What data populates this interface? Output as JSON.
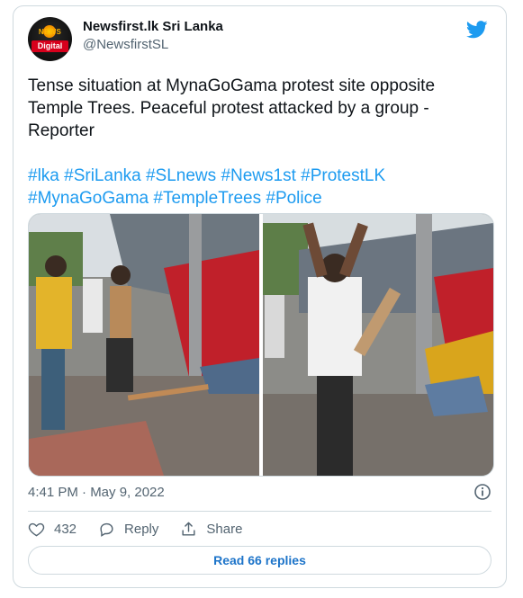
{
  "author": {
    "name": "Newsfirst.lk Sri Lanka",
    "handle": "@NewsfirstSL",
    "avatar_logo_top": "NEWS",
    "avatar_logo_bottom": "Digital"
  },
  "tweet": {
    "text": "Tense situation at MynaGoGama protest site opposite Temple Trees. Peaceful protest attacked by a group - Reporter",
    "hashtags": [
      "#lka",
      "#SriLanka",
      "#SLnews",
      "#News1st",
      "#ProtestLK",
      "#MynaGoGama",
      "#TempleTrees",
      "#Police"
    ],
    "timestamp": "4:41 PM · May 9, 2022"
  },
  "actions": {
    "likes": "432",
    "reply_label": "Reply",
    "share_label": "Share",
    "read_replies": "Read 66 replies"
  },
  "icons": {
    "brand": "twitter-bird-icon",
    "info": "info-icon",
    "like": "heart-icon",
    "reply": "speech-bubble-icon",
    "share": "share-icon"
  },
  "colors": {
    "link": "#1d9bf0",
    "read_replies": "#1d74c9",
    "secondary_text": "#536471",
    "border": "#cfd9de"
  }
}
